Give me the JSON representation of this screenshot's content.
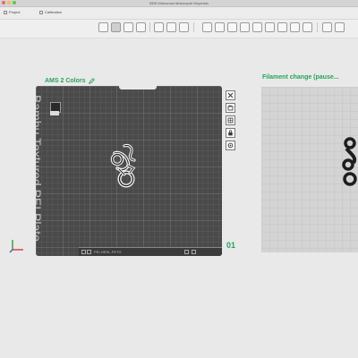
{
  "window": {
    "title": "BDE Motocross Motorcycle Keychain"
  },
  "tabs": [
    {
      "label": "Project"
    },
    {
      "label": "Calibration"
    }
  ],
  "toolbar": {
    "buttons": [
      "import-icon",
      "plate-icon",
      "arrange-icon",
      "grid-icon",
      "orient-icon",
      "layers-icon",
      "split-icon",
      "cut-icon",
      "move-icon",
      "rotate-icon",
      "scale-icon",
      "support-icon",
      "paint-icon",
      "seam-icon",
      "text-icon",
      "measure-icon",
      "assemble-icon",
      "view-icon"
    ]
  },
  "plate1": {
    "label": "AMS 2 Colors",
    "edit_icon": "pencil-icon",
    "bed_text": "Bambu Textured PEI Plate",
    "bottom_text": "PEI-HERL-PETG",
    "number": "01",
    "icons": [
      "close-icon",
      "auto-orient-icon",
      "arrange-icon",
      "lock-icon",
      "settings-icon"
    ]
  },
  "plate2": {
    "label": "Filament change (pause..."
  },
  "colors": {
    "accent": "#27a35a",
    "bed": "#4a4a4a",
    "bed_faded": "#d4d4d4"
  }
}
